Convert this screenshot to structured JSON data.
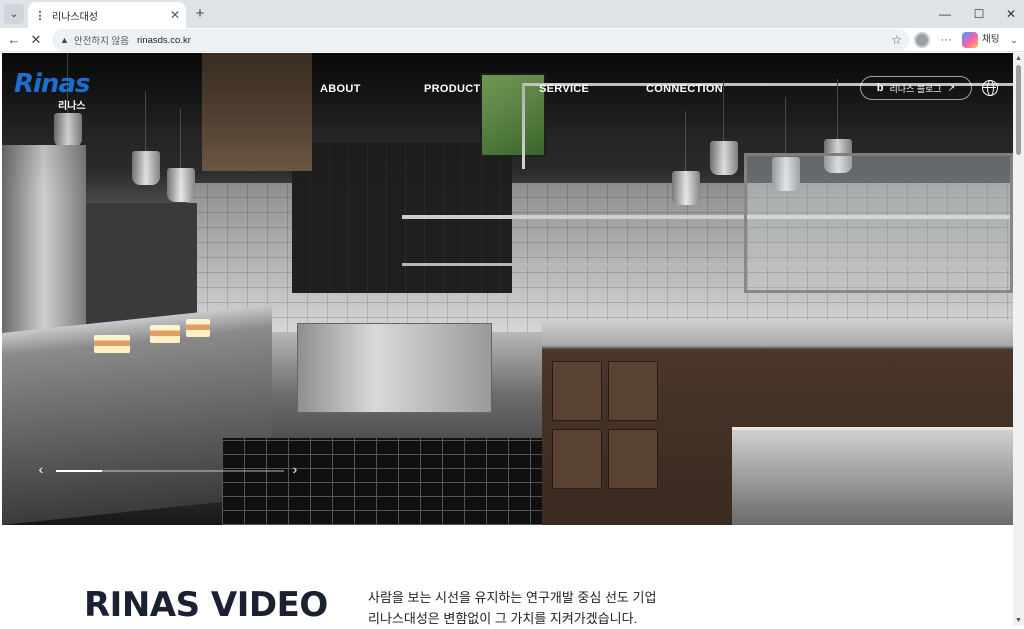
{
  "browser": {
    "tab_title": "리나스대성",
    "tab_favicon": "⋮",
    "address_security": "안전하지 않음",
    "address_url": "rinasds.co.kr",
    "chat_label": "채팅"
  },
  "site": {
    "logo_text": "Rinas",
    "logo_subtext": "리나스",
    "brand_color": "#1b6fd1",
    "nav": [
      {
        "label": "ABOUT"
      },
      {
        "label": "PRODUCT"
      },
      {
        "label": "SERVICE"
      },
      {
        "label": "CONNECTION"
      }
    ],
    "blog_button": {
      "icon": "b",
      "label": "리나스 블로그"
    },
    "slider": {
      "progress": 0.2
    }
  },
  "section": {
    "title": "RINAS VIDEO",
    "desc_line1": "사람을 보는 시선을 유지하는 연구개발 중심 선도 기업",
    "desc_line2": "리나스대성은 변함없이 그 가치를 지켜가겠습니다."
  }
}
